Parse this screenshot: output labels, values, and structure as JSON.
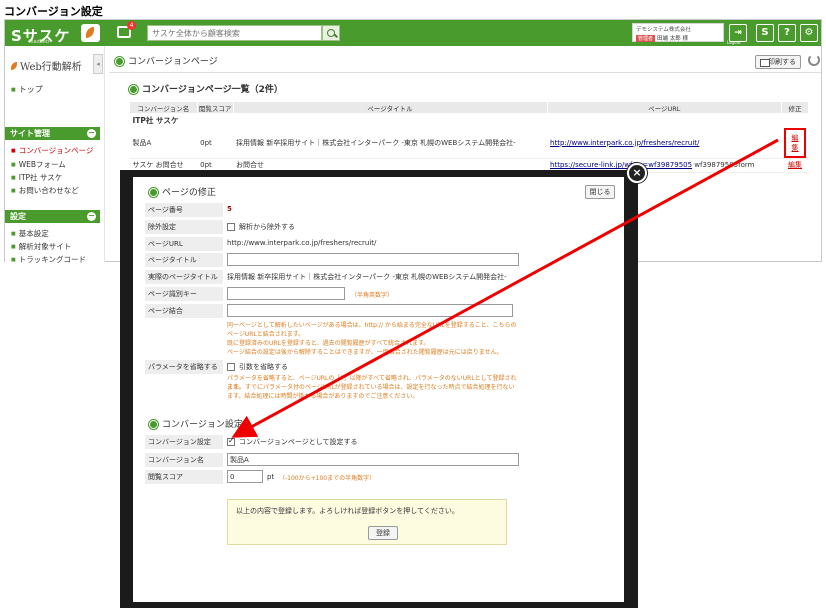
{
  "page_heading": "コンバージョン設定",
  "topbar": {
    "logo": "Sサスケ",
    "logo_sub": "leadbeb",
    "mail_badge": "4",
    "search_placeholder": "サスケ全体から顧客検索",
    "user_company": "デモシステム株式会社",
    "user_role": "管理者",
    "user_name": "田端 太郎 様",
    "logout_label": "Logout"
  },
  "sidebar": {
    "title": "Web行動解析",
    "top_link": "トップ",
    "site_section": "サイト管理",
    "site_items": [
      "コンバージョンページ",
      "WEBフォーム",
      "ITP社 サスケ",
      "お問い合わせなど"
    ],
    "settings_section": "設定",
    "settings_items": [
      "基本設定",
      "解析対象サイト",
      "トラッキングコード"
    ]
  },
  "main": {
    "title": "コンバージョンページ",
    "print_label": "印刷する",
    "list_title": "コンバージョンページ一覧（2件）",
    "columns": [
      "コンバージョン名",
      "閲覧スコア",
      "ページタイトル",
      "ページURL",
      "修正"
    ],
    "group_label": "ITP社 サスケ",
    "rows": [
      {
        "name": "製品A",
        "score": "0pt",
        "title": "採用情報 新卒採用サイト｜株式会社インターパーク -東京 札幌のWEBシステム開発会社-",
        "url": "http://www.interpark.co.jp/freshers/recruit/",
        "edit": "編集"
      },
      {
        "name": "サスケ お問合せ",
        "score": "0pt",
        "title": "お問合せ",
        "url": "https://secure-link.jp/wf/?c=wf39879505",
        "url_extra": "wf39879505form",
        "edit": "編集"
      }
    ]
  },
  "modal": {
    "close_symbol": "×",
    "title": "ページの修正",
    "close_label": "閉じる",
    "fields": {
      "page_number_label": "ページ番号",
      "page_number": "5",
      "exclude_label": "除外設定",
      "exclude_text": "解析から除外する",
      "page_url_label": "ページURL",
      "page_url": "http://www.interpark.co.jp/freshers/recruit/",
      "page_title_label": "ページタイトル",
      "actual_title_label": "実際のページタイトル",
      "actual_title": "採用情報 新卒採用サイト｜株式会社インターパーク -東京 札幌のWEBシステム開発会社-",
      "page_key_label": "ページ識別キー",
      "page_key_hint": "（半角英数字）",
      "merge_label": "ページ結合",
      "merge_note_1": "同一ページとして解析したいページがある場合は、http:// から始まる完全なURLを登録すること、こちらのページURLと結合されます。",
      "merge_note_2": "既に登録済みのURLを登録すると、過去の閲覧履歴がすべて統合されます。",
      "merge_note_3": "ページ結合の設定は後から解除することはできますが、一度結合された閲覧履歴は元には戻りません。",
      "omit_label": "パラメータを省略する",
      "omit_text": "引数を省略する",
      "omit_note_1": "パラメータを省略すると、ページURLの「?」以降がすべて省略され、パラメータのないURLとして登録されます。",
      "omit_note_2": "また、すでにパラメータ付のページURLが登録されている場合は、設定を行なった時点で結合処理を行ないます。結合処理には時間が掛かる場合がありますのでご注意ください。"
    },
    "cv_section_title": "コンバージョン設定",
    "cv_setting_label": "コンバージョン設定",
    "cv_setting_text": "コンバージョンページとして設定する",
    "cv_name_label": "コンバージョン名",
    "cv_name_value": "製品A",
    "score_label": "閲覧スコア",
    "score_value": "0",
    "score_unit": "pt",
    "score_hint": "（-100から+100までの半角数字）",
    "confirm_text": "以上の内容で登録します。よろしければ登録ボタンを押してください。",
    "submit_label": "登録"
  },
  "colors": {
    "brand_green": "#4a9b2d",
    "alert_red": "#e00000",
    "hint_orange": "#e07b1f"
  }
}
